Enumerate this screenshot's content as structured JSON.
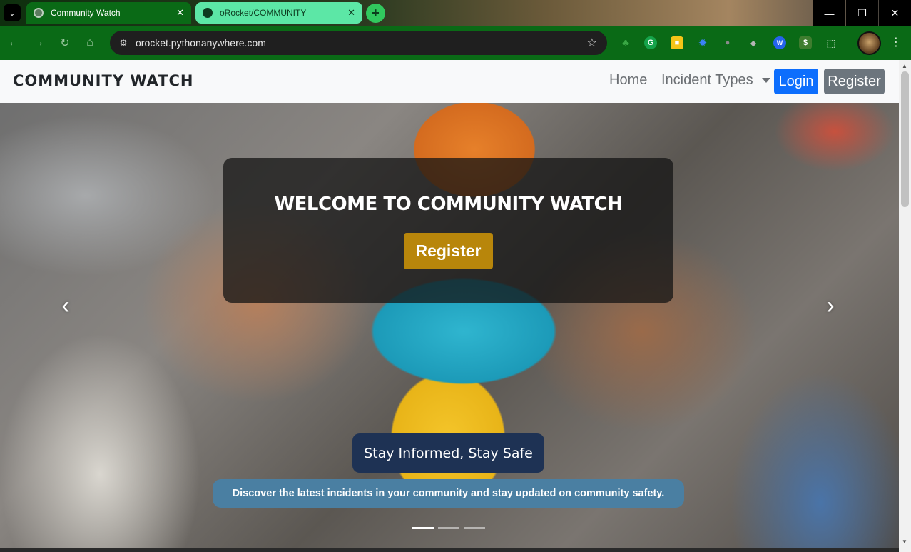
{
  "browser": {
    "tabs": [
      {
        "title": "Community Watch",
        "active": true,
        "close": "✕"
      },
      {
        "title": "oRocket/COMMUNITY",
        "active": false,
        "close": "✕"
      }
    ],
    "new_tab": "+",
    "tab_menu": "⌄",
    "window_controls": {
      "minimize": "—",
      "restore": "❐",
      "close": "✕"
    },
    "nav": {
      "back": "←",
      "forward": "→",
      "reload": "↻",
      "home": "⌂"
    },
    "address": "orocket.pythonanywhere.com",
    "site_info_icon": "⚙",
    "star_icon": "☆",
    "extensions": [
      {
        "name": "tree-extension-icon",
        "glyph": "♣",
        "color": "#2e8b3a"
      },
      {
        "name": "grammarly-extension-icon",
        "glyph": "G",
        "color": "#15a34a"
      },
      {
        "name": "notes-extension-icon",
        "glyph": "■",
        "color": "#f5c518"
      },
      {
        "name": "gear-extension-icon",
        "glyph": "✹",
        "color": "#2a6de0"
      },
      {
        "name": "bulb-extension-icon",
        "glyph": "●",
        "color": "#777777"
      },
      {
        "name": "layers-extension-icon",
        "glyph": "◆",
        "color": "#a0a0a0"
      },
      {
        "name": "wp-extension-icon",
        "glyph": "W",
        "color": "#2563eb"
      },
      {
        "name": "dollar-extension-icon",
        "glyph": "$",
        "color": "#3f7d2f"
      },
      {
        "name": "puzzle-extension-icon",
        "glyph": "⬚",
        "color": "#0a6a16"
      }
    ],
    "kebab": "⋮"
  },
  "site": {
    "brand": "COMMUNITY WATCH",
    "nav": {
      "home": "Home",
      "incident_types": "Incident Types",
      "login": "Login",
      "register": "Register"
    },
    "hero": {
      "welcome": "WELCOME TO COMMUNITY WATCH",
      "register_button": "Register",
      "prev_arrow": "‹",
      "next_arrow": "›",
      "tagline": "Stay Informed, Stay Safe",
      "subtagline": "Discover the latest incidents in your community and stay updated on community safety.",
      "slides": 3,
      "active_slide": 1
    }
  },
  "colors": {
    "login_button": "#0d6efd",
    "register_nav_button": "#6c757d",
    "hero_register_button": "#b8860b",
    "tagline_bg": "#1e3254",
    "subtagline_bg": "#4a7fa2"
  }
}
